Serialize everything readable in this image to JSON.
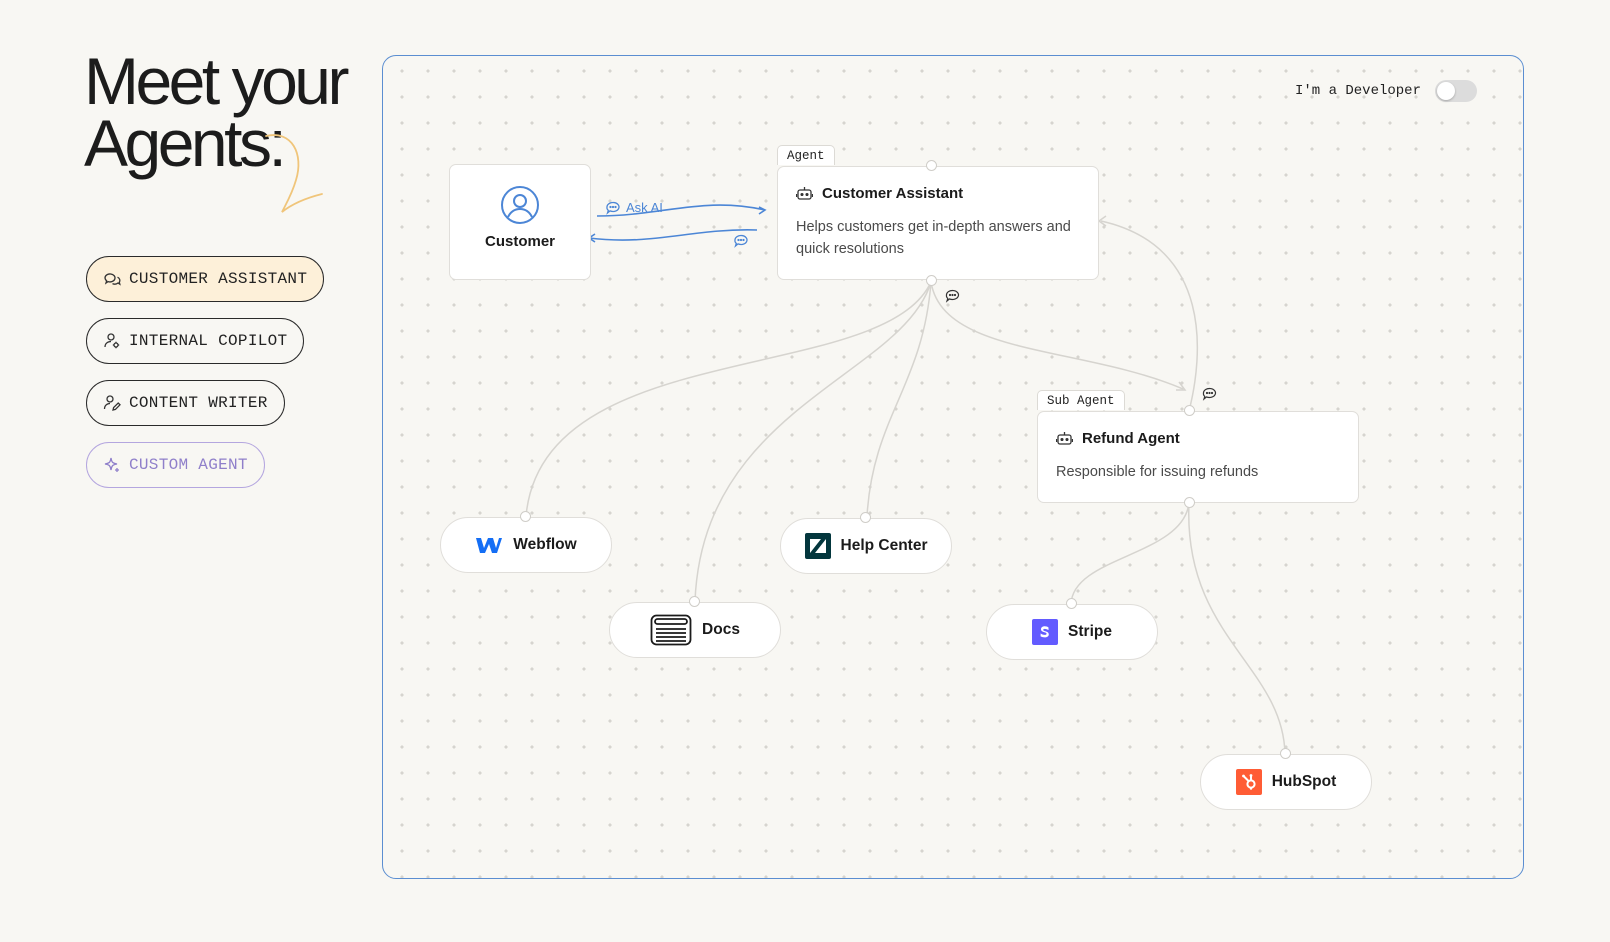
{
  "headline": {
    "line1": "Meet your",
    "line2": "Agents:"
  },
  "agent_types": [
    {
      "label": "CUSTOMER ASSISTANT",
      "icon": "chat-bubbles-icon",
      "active": true
    },
    {
      "label": "INTERNAL COPILOT",
      "icon": "user-gear-icon",
      "active": false
    },
    {
      "label": "CONTENT WRITER",
      "icon": "user-pen-icon",
      "active": false
    },
    {
      "label": "CUSTOM AGENT",
      "icon": "sparkle-icon",
      "active": false
    }
  ],
  "developer_toggle": {
    "label": "I'm a Developer",
    "on": false
  },
  "diagram": {
    "customer": {
      "label": "Customer",
      "icon": "user-circle-icon"
    },
    "ask_ai": {
      "label": "Ask AI",
      "icon": "chat-bubble-icon"
    },
    "main_agent": {
      "tag": "Agent",
      "title": "Customer Assistant",
      "description": "Helps customers get in-depth answers and quick resolutions",
      "icon": "robot-icon"
    },
    "sub_agent": {
      "tag": "Sub Agent",
      "title": "Refund Agent",
      "description": "Responsible for issuing refunds",
      "icon": "robot-icon"
    },
    "integrations": {
      "webflow": {
        "label": "Webflow",
        "icon": "webflow-logo-icon",
        "color": "#146ef5"
      },
      "docs": {
        "label": "Docs",
        "icon": "docs-browser-icon"
      },
      "help_center": {
        "label": "Help Center",
        "icon": "zendesk-logo-icon",
        "color": "#03363d"
      },
      "stripe": {
        "label": "Stripe",
        "icon": "stripe-logo-icon",
        "color": "#635bff"
      },
      "hubspot": {
        "label": "HubSpot",
        "icon": "hubspot-logo-icon",
        "color": "#ff5c35"
      }
    }
  },
  "colors": {
    "accent_blue": "#4c86d6",
    "active_bg": "#fdf0d9",
    "custom_purple": "#8f7fca",
    "edge": "#d6d4cf"
  }
}
